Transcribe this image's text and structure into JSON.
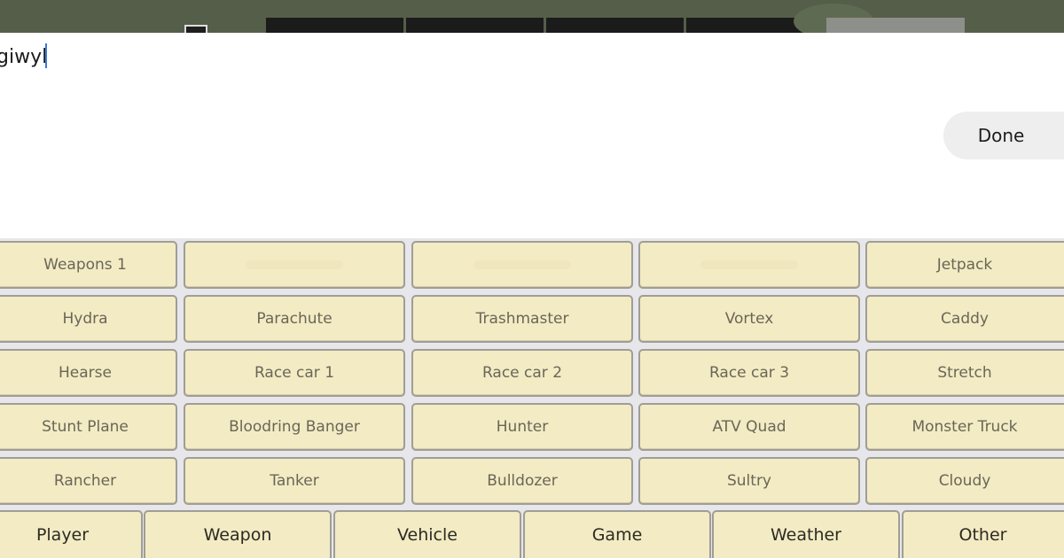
{
  "input": {
    "value": "giwyl",
    "placeholder": ""
  },
  "done_label": "Done",
  "cheat_rows": [
    [
      "Weapons 1",
      "",
      "",
      "",
      "Jetpack"
    ],
    [
      "Hydra",
      "Parachute",
      "Trashmaster",
      "Vortex",
      "Caddy"
    ],
    [
      "Hearse",
      "Race car 1",
      "Race car 2",
      "Race car 3",
      "Stretch"
    ],
    [
      "Stunt Plane",
      "Bloodring Banger",
      "Hunter",
      "ATV Quad",
      "Monster Truck"
    ],
    [
      "Rancher",
      "Tanker",
      "Bulldozer",
      "Sultry",
      "Cloudy"
    ]
  ],
  "categories": [
    "Player",
    "Weapon",
    "Vehicle",
    "Game",
    "Weather",
    "Other"
  ],
  "colors": {
    "key_fill": "#f3ebc3",
    "key_border": "#9f9d97",
    "keyboard_bg": "#e7e6ea",
    "caret": "#3d7bd9"
  }
}
